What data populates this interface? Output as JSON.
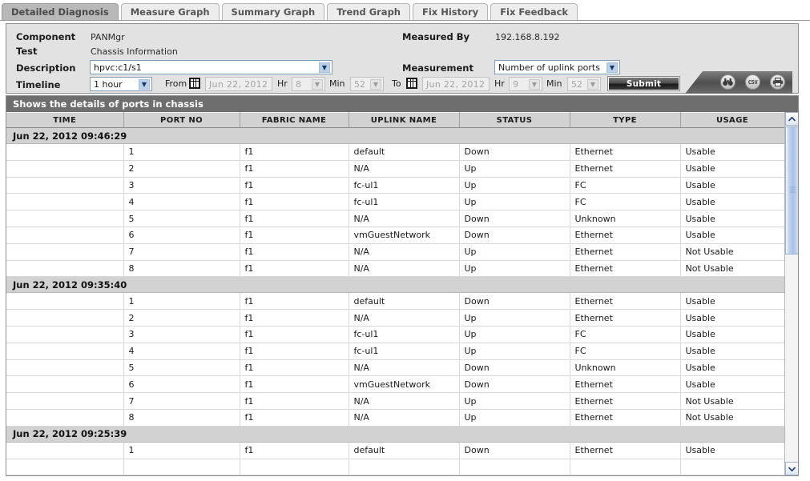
{
  "tabs": [
    {
      "label": "Detailed Diagnosis",
      "active": true
    },
    {
      "label": "Measure Graph",
      "active": false
    },
    {
      "label": "Summary Graph",
      "active": false
    },
    {
      "label": "Trend Graph",
      "active": false
    },
    {
      "label": "Fix History",
      "active": false
    },
    {
      "label": "Fix Feedback",
      "active": false
    }
  ],
  "form": {
    "component_label": "Component",
    "component_value": "PANMgr",
    "test_label": "Test",
    "test_value": "Chassis Information",
    "description_label": "Description",
    "description_value": "hpvc:c1/s1",
    "timeline_label": "Timeline",
    "timeline_value": "1 hour",
    "measured_by_label": "Measured By",
    "measured_by_value": "192.168.8.192",
    "measurement_label": "Measurement",
    "measurement_value": "Number of uplink ports",
    "from_label": "From",
    "from_date": "Jun 22, 2012",
    "from_hr_label": "Hr",
    "from_hr": "8",
    "from_min_label": "Min",
    "from_min": "52",
    "to_label": "To",
    "to_date": "Jun 22, 2012",
    "to_hr_label": "Hr",
    "to_hr": "9",
    "to_min_label": "Min",
    "to_min": "52",
    "submit_label": "Submit"
  },
  "toolbar": {
    "icons": [
      {
        "name": "binoculars-icon",
        "title": "Search"
      },
      {
        "name": "csv-icon",
        "title": "CSV",
        "text": "CSV"
      },
      {
        "name": "printer-icon",
        "title": "Print"
      }
    ]
  },
  "grid": {
    "title": "Shows the details of ports in chassis",
    "columns": [
      "TIME",
      "PORT NO",
      "FABRIC NAME",
      "UPLINK NAME",
      "STATUS",
      "TYPE",
      "USAGE"
    ],
    "groups": [
      {
        "time": "Jun 22, 2012 09:46:29",
        "rows": [
          {
            "port": "1",
            "fabric": "f1",
            "uplink": "default",
            "status": "Down",
            "type": "Ethernet",
            "usage": "Usable"
          },
          {
            "port": "2",
            "fabric": "f1",
            "uplink": "N/A",
            "status": "Up",
            "type": "Ethernet",
            "usage": "Usable"
          },
          {
            "port": "3",
            "fabric": "f1",
            "uplink": "fc-ul1",
            "status": "Up",
            "type": "FC",
            "usage": "Usable"
          },
          {
            "port": "4",
            "fabric": "f1",
            "uplink": "fc-ul1",
            "status": "Up",
            "type": "FC",
            "usage": "Usable"
          },
          {
            "port": "5",
            "fabric": "f1",
            "uplink": "N/A",
            "status": "Down",
            "type": "Unknown",
            "usage": "Usable"
          },
          {
            "port": "6",
            "fabric": "f1",
            "uplink": "vmGuestNetwork",
            "status": "Down",
            "type": "Ethernet",
            "usage": "Usable"
          },
          {
            "port": "7",
            "fabric": "f1",
            "uplink": "N/A",
            "status": "Up",
            "type": "Ethernet",
            "usage": "Not Usable"
          },
          {
            "port": "8",
            "fabric": "f1",
            "uplink": "N/A",
            "status": "Up",
            "type": "Ethernet",
            "usage": "Not Usable"
          }
        ]
      },
      {
        "time": "Jun 22, 2012 09:35:40",
        "rows": [
          {
            "port": "1",
            "fabric": "f1",
            "uplink": "default",
            "status": "Down",
            "type": "Ethernet",
            "usage": "Usable"
          },
          {
            "port": "2",
            "fabric": "f1",
            "uplink": "N/A",
            "status": "Up",
            "type": "Ethernet",
            "usage": "Usable"
          },
          {
            "port": "3",
            "fabric": "f1",
            "uplink": "fc-ul1",
            "status": "Up",
            "type": "FC",
            "usage": "Usable"
          },
          {
            "port": "4",
            "fabric": "f1",
            "uplink": "fc-ul1",
            "status": "Up",
            "type": "FC",
            "usage": "Usable"
          },
          {
            "port": "5",
            "fabric": "f1",
            "uplink": "N/A",
            "status": "Down",
            "type": "Unknown",
            "usage": "Usable"
          },
          {
            "port": "6",
            "fabric": "f1",
            "uplink": "vmGuestNetwork",
            "status": "Down",
            "type": "Ethernet",
            "usage": "Usable"
          },
          {
            "port": "7",
            "fabric": "f1",
            "uplink": "N/A",
            "status": "Up",
            "type": "Ethernet",
            "usage": "Not Usable"
          },
          {
            "port": "8",
            "fabric": "f1",
            "uplink": "N/A",
            "status": "Up",
            "type": "Ethernet",
            "usage": "Not Usable"
          }
        ]
      },
      {
        "time": "Jun 22, 2012 09:25:39",
        "rows": [
          {
            "port": "1",
            "fabric": "f1",
            "uplink": "default",
            "status": "Down",
            "type": "Ethernet",
            "usage": "Usable"
          },
          {
            "port": "",
            "fabric": "",
            "uplink": "",
            "status": "",
            "type": "",
            "usage": ""
          }
        ]
      }
    ]
  },
  "colors": {
    "accent": "#a9c0e6",
    "panel": "#e2e2e2",
    "group_row": "#d2d2d2",
    "title_bar": "#6e6e6e",
    "active_tab": "#b8b8b8"
  }
}
